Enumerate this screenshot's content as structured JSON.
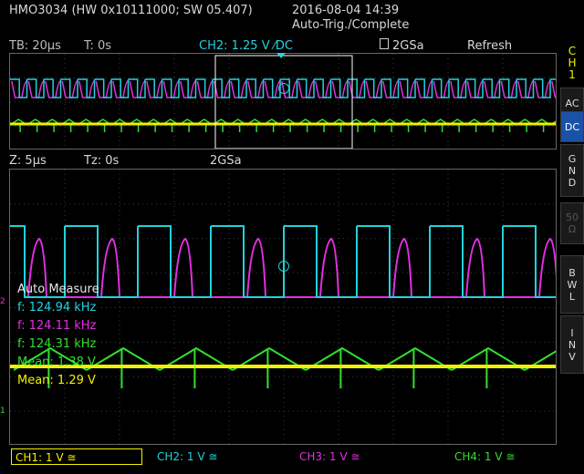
{
  "header": {
    "device": "HMO3034 (HW 0x10111000; SW 05.407)",
    "datetime": "2016-08-04 14:39",
    "status": "Auto-Trig./Complete"
  },
  "status_bar": {
    "timebase": "TB: 20µs",
    "trigger_time": "T: 0s",
    "trigger_source": "CH2: 1.25 V ⁄DC",
    "sample_rate": "2GSa",
    "mode": "Refresh"
  },
  "zoom_bar": {
    "zoom": "Z: 5µs",
    "zoom_time": "Tz: 0s",
    "sample_rate": "2GSa"
  },
  "side_menu": {
    "channel": [
      "C",
      "H",
      "1"
    ],
    "items": [
      {
        "lines": [
          "AC"
        ],
        "active": false
      },
      {
        "lines": [
          "DC"
        ],
        "active": true
      },
      {
        "lines": [
          "G",
          "N",
          "D"
        ],
        "active": false
      },
      {
        "lines": [
          "50",
          "Ω"
        ],
        "active": false,
        "disabled": true
      },
      {
        "lines": [
          "B",
          "W",
          "L"
        ],
        "active": false
      },
      {
        "lines": [
          "I",
          "N",
          "V"
        ],
        "active": false
      }
    ]
  },
  "auto_measure": {
    "title": "Auto Measure",
    "rows": [
      {
        "text": "f: 124.94 kHz",
        "color": "#22d2dc"
      },
      {
        "text": "f: 124.11 kHz",
        "color": "#e030e0"
      },
      {
        "text": "f: 124.31 kHz",
        "color": "#30e030"
      },
      {
        "text": "Mean: 1.38 V",
        "color": "#30e030"
      },
      {
        "text": "Mean: 1.29 V",
        "color": "#f0f000"
      }
    ]
  },
  "channels": [
    {
      "label": "CH1: 1 V ≅",
      "color": "#f0f000",
      "selected": true
    },
    {
      "label": "CH2: 1 V ≅",
      "color": "#22d2dc",
      "selected": false
    },
    {
      "label": "CH3: 1 V ≅",
      "color": "#e030e0",
      "selected": false
    },
    {
      "label": "CH4: 1 V ≅",
      "color": "#30e030",
      "selected": false
    }
  ],
  "markers": {
    "ch2_label": "2",
    "ch1_label": "1"
  }
}
